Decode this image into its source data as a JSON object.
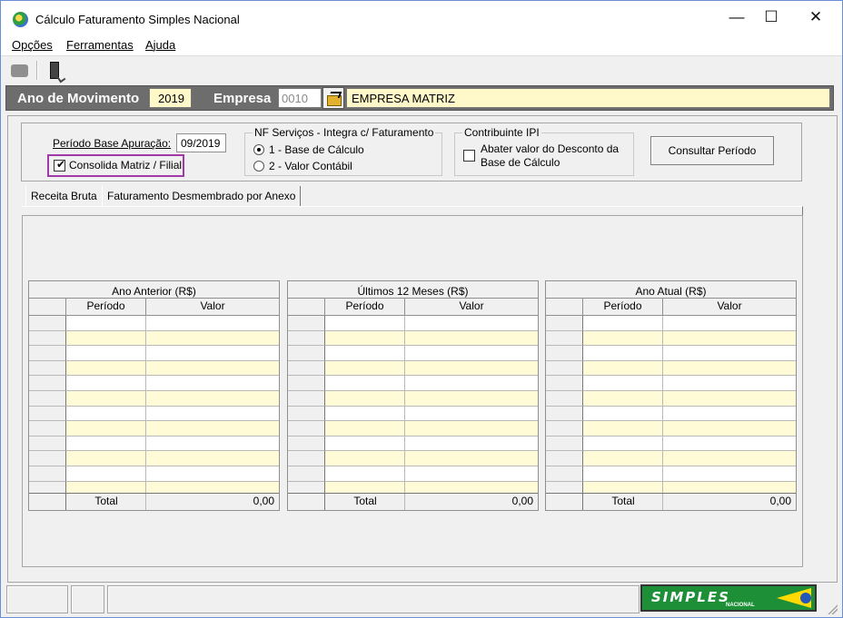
{
  "window": {
    "title": "Cálculo Faturamento Simples Nacional",
    "controls": {
      "minimize": "—",
      "maximize": "☐",
      "close": "✕"
    },
    "app_icon": "colored-circle-icon"
  },
  "menu": [
    {
      "label": "Opções"
    },
    {
      "label": "Ferramentas"
    },
    {
      "label": "Ajuda"
    }
  ],
  "toolbar": {
    "icons": [
      "print-icon",
      "exit-door-icon"
    ]
  },
  "header": {
    "ano_label": "Ano de Movimento",
    "ano_value": "2019",
    "empresa_label": "Empresa",
    "empresa_code": "0010",
    "empresa_name": "EMPRESA MATRIZ",
    "folder_icon": "open-folder-icon"
  },
  "filters": {
    "periodo_label": "Período Base Apuração:",
    "periodo_value": "09/2019",
    "consolida_label": "Consolida Matriz / Filial",
    "consolida_checked": true,
    "nf_group_title": "NF Serviços - Integra c/ Faturamento",
    "nf_options": [
      "1 - Base de Cálculo",
      "2 - Valor Contábil"
    ],
    "nf_selected": 0,
    "ipi_group_title": "Contribuinte IPI",
    "ipi_line1": "Abater valor do Desconto da",
    "ipi_line2": "Base de Cálculo",
    "ipi_checked": false,
    "consult_button": "Consultar Período"
  },
  "tabs": [
    {
      "label": "Receita Bruta",
      "active": true
    },
    {
      "label": "Faturamento Desmembrado por Anexo",
      "active": false
    }
  ],
  "grids": [
    {
      "title": "Ano Anterior (R$)",
      "col_periodo": "Período",
      "col_valor": "Valor",
      "total_label": "Total",
      "total_value": "0,00"
    },
    {
      "title": "Últimos 12 Meses (R$)",
      "col_periodo": "Período",
      "col_valor": "Valor",
      "total_label": "Total",
      "total_value": "0,00"
    },
    {
      "title": "Ano Atual (R$)",
      "col_periodo": "Período",
      "col_valor": "Valor",
      "total_label": "Total",
      "total_value": "0,00"
    }
  ],
  "statusbar": {
    "logo_text": "SIMPLES",
    "logo_sub": "NACIONAL",
    "logo_colors": {
      "green": "#1c8f37",
      "yellow": "#ffd900",
      "blue": "#2557b8"
    }
  }
}
